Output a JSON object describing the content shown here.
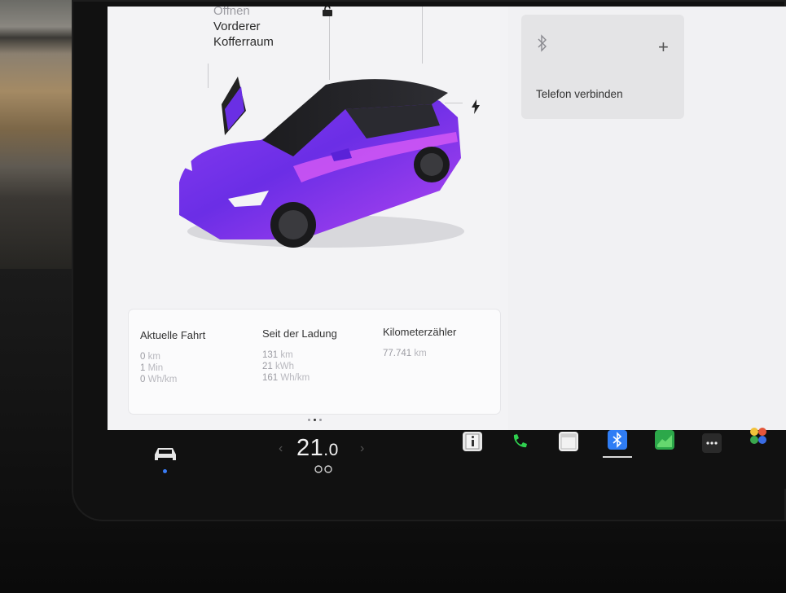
{
  "car_panel": {
    "trunk_label_top": "Öffnen",
    "trunk_label_1": "Vorderer",
    "trunk_label_2": "Kofferraum",
    "car_color": "#9b2bf0"
  },
  "stats": {
    "current_trip": {
      "title": "Aktuelle Fahrt",
      "distance": "0",
      "distance_unit": "km",
      "duration": "1",
      "duration_unit": "Min",
      "energy": "0",
      "energy_unit": "Wh/km"
    },
    "since_charge": {
      "title": "Seit der Ladung",
      "distance": "131",
      "distance_unit": "km",
      "energy": "21",
      "energy_unit": "kWh",
      "efficiency": "161",
      "efficiency_unit": "Wh/km"
    },
    "odometer": {
      "title": "Kilometerzähler",
      "value": "77.741",
      "unit": "km"
    }
  },
  "phone_card": {
    "label": "Telefon verbinden",
    "plus": "+"
  },
  "taskbar": {
    "temp_left_arrow": "‹",
    "temp_whole": "21",
    "temp_decimal": ".0",
    "temp_right_arrow": "›",
    "apps": [
      {
        "name": "manual-app-icon",
        "color": "#e6e6e6"
      },
      {
        "name": "phone-app-icon",
        "color": "#2fcf4f"
      },
      {
        "name": "calendar-app-icon",
        "color": "#f0f0f0"
      },
      {
        "name": "bluetooth-app-icon",
        "color": "#2f7df5"
      },
      {
        "name": "energy-app-icon",
        "color": "#2ca84a"
      },
      {
        "name": "more-app-icon",
        "color": "#2a2a2a"
      },
      {
        "name": "toybox-app-icon",
        "color": "#e4563a"
      }
    ]
  }
}
